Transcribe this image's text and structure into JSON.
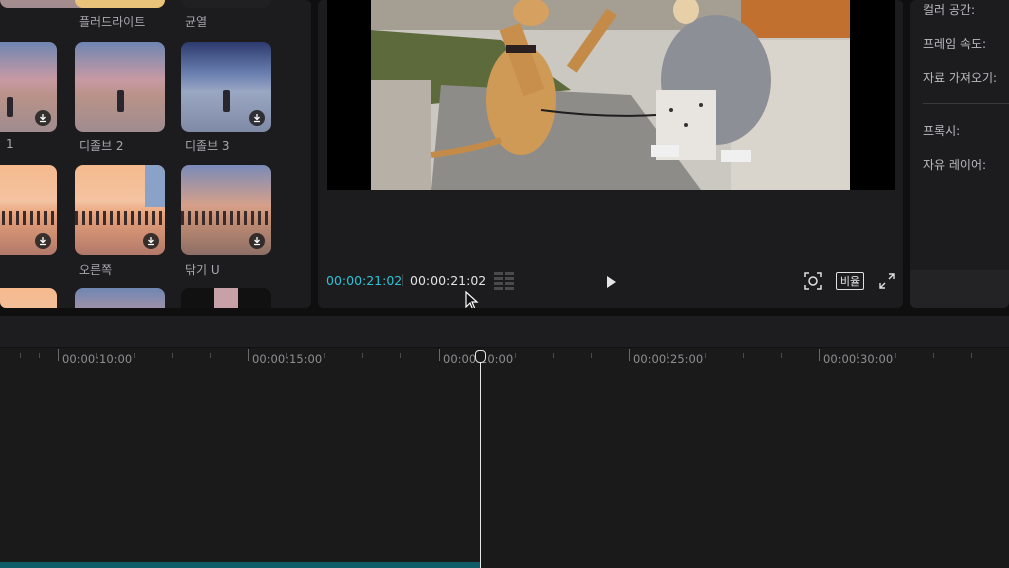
{
  "effects": {
    "items": [
      {
        "label": "플러드라이트"
      },
      {
        "label": "균열"
      },
      {
        "label": "1"
      },
      {
        "label": "디졸브 2"
      },
      {
        "label": "디졸브 3"
      },
      {
        "label": "오른쪽"
      },
      {
        "label": "닦기 U"
      }
    ]
  },
  "player": {
    "current_time": "00:00:21:02",
    "total_time": "00:00:21:02",
    "ratio_label": "비율",
    "accent": "#2cc2d6"
  },
  "properties": {
    "labels": [
      "컬러 공간:",
      "프레임 속도:",
      "자료 가져오기:",
      "프록시:",
      "자유 레이어:"
    ]
  },
  "timeline": {
    "ticks": [
      "00:00:10:00",
      "00:00:15:00",
      "00:00:20:00",
      "00:00:25:00",
      "00:00:30:00"
    ]
  },
  "icons": [
    "download-icon",
    "grid-icon",
    "play-icon",
    "focus-icon",
    "fullscreen-icon",
    "mouse-cursor-icon"
  ]
}
